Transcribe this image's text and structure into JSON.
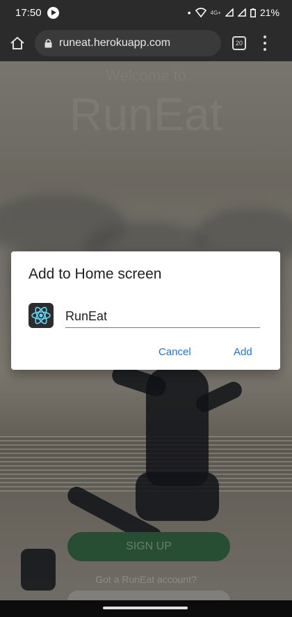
{
  "status_bar": {
    "time": "17:50",
    "network": "4G+",
    "battery": "21%"
  },
  "browser": {
    "url": "runeat.herokuapp.com",
    "tab_count": "20"
  },
  "page": {
    "welcome": "Welcome to",
    "brand": "RunEat",
    "signup_label": "SIGN UP",
    "account_prompt": "Got a RunEat account?"
  },
  "dialog": {
    "title": "Add to Home screen",
    "app_name": "RunEat",
    "cancel_label": "Cancel",
    "add_label": "Add"
  },
  "colors": {
    "accent": "#1a73e8",
    "react_icon": "#61dafb",
    "signup_button": "#2e5b3b"
  }
}
